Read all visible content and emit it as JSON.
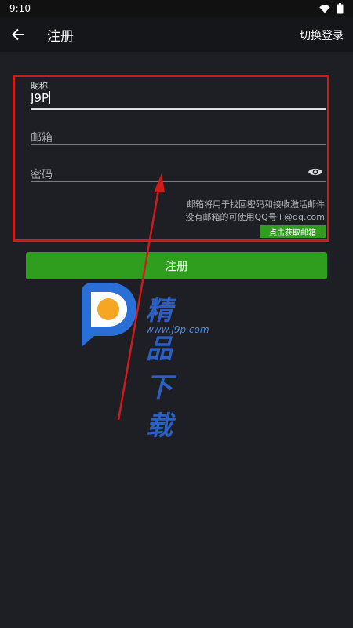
{
  "status_bar": {
    "time": "9:10"
  },
  "app_bar": {
    "title": "注册",
    "switch_login": "切换登录"
  },
  "form": {
    "nickname": {
      "label": "昵称",
      "value": "J9P"
    },
    "email": {
      "placeholder": "邮箱"
    },
    "password": {
      "placeholder": "密码"
    },
    "hint_line1": "邮箱将用于找回密码和接收激活邮件",
    "hint_line2": "没有邮箱的可使用QQ号+@qq.com",
    "get_email_label": "点击获取邮箱"
  },
  "register_button": {
    "label": "注册"
  },
  "watermark": {
    "text": "精品下载",
    "url": "www.j9p.com"
  },
  "colors": {
    "accent_green": "#2f9e1f",
    "annotation_red": "#d11b1b",
    "background": "#1e1f24"
  }
}
